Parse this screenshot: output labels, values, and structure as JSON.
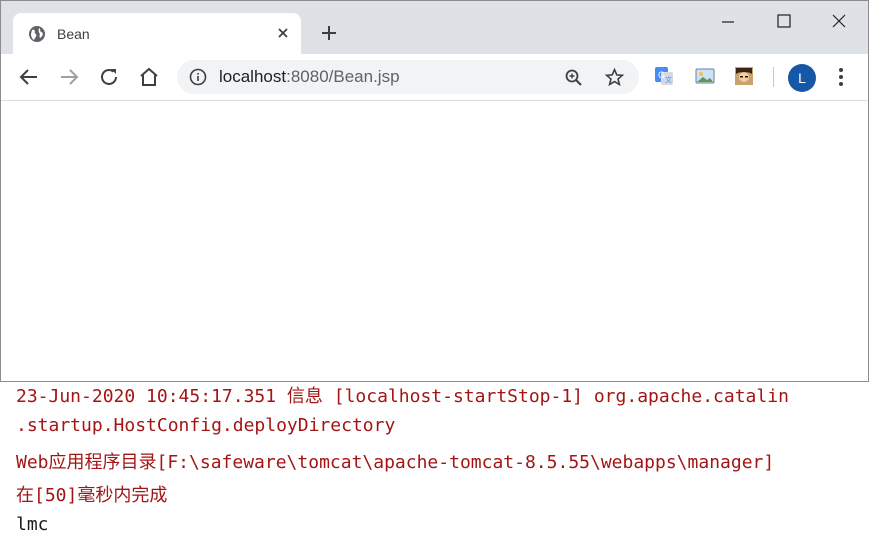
{
  "browser": {
    "tab": {
      "title": "Bean"
    },
    "address_bar": {
      "host": "localhost",
      "rest": ":8080/Bean.jsp"
    },
    "profile": {
      "initial": "L"
    }
  },
  "console": {
    "lines": [
      "23-Jun-2020 10:45:17.351 信息 [localhost-startStop-1] org.apache.catalin",
      " .startup.HostConfig.deployDirectory",
      " Web应用程序目录[F:\\safeware\\tomcat\\apache-tomcat-8.5.55\\webapps\\manager]",
      " 在[50]毫秒内完成",
      "lmc"
    ]
  },
  "colors": {
    "accent": "#1558a8",
    "log_red": "#a31515"
  }
}
